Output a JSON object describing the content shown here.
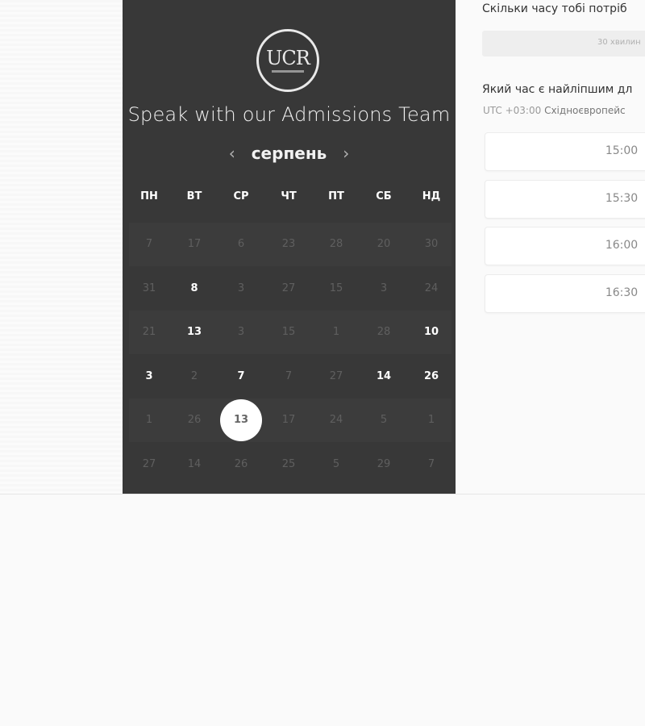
{
  "colors": {
    "panel": "#383838",
    "page": "#fafafa",
    "selected_day_bg": "#ffffff"
  },
  "calendar": {
    "logo_text": "UCR",
    "title": "Speak with our Admissions Team",
    "month": "серпень",
    "prev_icon": "chevron-left-icon",
    "next_icon": "chevron-right-icon",
    "weekdays": [
      "ПН",
      "ВТ",
      "СР",
      "ЧТ",
      "ПТ",
      "СБ",
      "НД"
    ],
    "weeks": [
      [
        {
          "d": "7",
          "a": false
        },
        {
          "d": "17",
          "a": false
        },
        {
          "d": "6",
          "a": false
        },
        {
          "d": "23",
          "a": false
        },
        {
          "d": "28",
          "a": false
        },
        {
          "d": "20",
          "a": false
        },
        {
          "d": "30",
          "a": false
        }
      ],
      [
        {
          "d": "31",
          "a": false
        },
        {
          "d": "8",
          "a": true
        },
        {
          "d": "3",
          "a": false
        },
        {
          "d": "27",
          "a": false
        },
        {
          "d": "15",
          "a": false
        },
        {
          "d": "3",
          "a": false
        },
        {
          "d": "24",
          "a": false
        }
      ],
      [
        {
          "d": "21",
          "a": false
        },
        {
          "d": "13",
          "a": true
        },
        {
          "d": "3",
          "a": false
        },
        {
          "d": "15",
          "a": false
        },
        {
          "d": "1",
          "a": false
        },
        {
          "d": "28",
          "a": false
        },
        {
          "d": "10",
          "a": true
        }
      ],
      [
        {
          "d": "3",
          "a": true
        },
        {
          "d": "2",
          "a": false
        },
        {
          "d": "7",
          "a": true
        },
        {
          "d": "7",
          "a": false
        },
        {
          "d": "27",
          "a": false
        },
        {
          "d": "14",
          "a": true
        },
        {
          "d": "26",
          "a": true
        }
      ],
      [
        {
          "d": "1",
          "a": false
        },
        {
          "d": "26",
          "a": false
        },
        {
          "d": "13",
          "a": true,
          "sel": true
        },
        {
          "d": "17",
          "a": false
        },
        {
          "d": "24",
          "a": false
        },
        {
          "d": "5",
          "a": false
        },
        {
          "d": "1",
          "a": false
        }
      ],
      [
        {
          "d": "27",
          "a": false
        },
        {
          "d": "14",
          "a": false
        },
        {
          "d": "26",
          "a": false
        },
        {
          "d": "25",
          "a": false
        },
        {
          "d": "5",
          "a": false
        },
        {
          "d": "29",
          "a": false
        },
        {
          "d": "7",
          "a": false
        }
      ]
    ]
  },
  "booking": {
    "duration_question": "Скільки часу тобі потріб",
    "duration_value": "30 хвилин",
    "time_question": "Який час є найліпшим дл",
    "timezone_offset": "UTC +03:00",
    "timezone_name": "Східноєвропейс",
    "slots": [
      "15:00",
      "15:30",
      "16:00",
      "16:30"
    ]
  }
}
